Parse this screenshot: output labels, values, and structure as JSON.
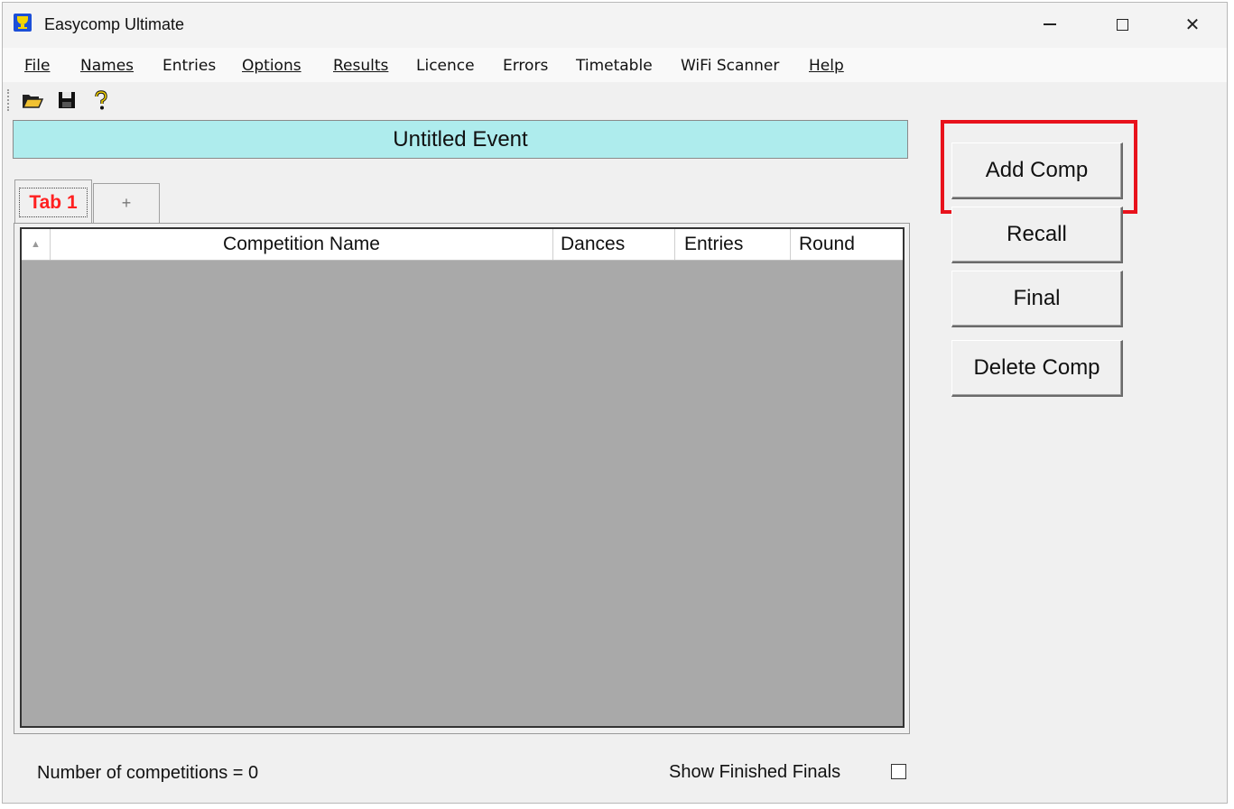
{
  "window": {
    "title": "Easycomp Ultimate",
    "minimize_glyph": "—",
    "close_glyph": "✕"
  },
  "menu": [
    {
      "label": "File"
    },
    {
      "label": "Names"
    },
    {
      "label": "Entries"
    },
    {
      "label": "Options"
    },
    {
      "label": "Results"
    },
    {
      "label": "Licence"
    },
    {
      "label": "Errors"
    },
    {
      "label": "Timetable"
    },
    {
      "label": "WiFi Scanner"
    },
    {
      "label": "Help"
    }
  ],
  "toolbar": {
    "icons": [
      "open-folder-icon",
      "save-disk-icon",
      "help-question-icon"
    ]
  },
  "event": {
    "title": "Untitled Event"
  },
  "tabs": [
    {
      "label": "Tab 1",
      "active": true
    },
    {
      "label": "+"
    }
  ],
  "table": {
    "columns": [
      "Competition Name",
      "Dances",
      "Entries",
      "Round"
    ],
    "rows": []
  },
  "buttons": {
    "add_comp": "Add Comp",
    "recall": "Recall",
    "final": "Final",
    "delete_comp": "Delete Comp"
  },
  "status": {
    "count_text": "Number of competitions = 0",
    "show_finished_label": "Show Finished Finals",
    "show_finished_checked": false
  },
  "colors": {
    "event_banner": "#aeeced",
    "list_background": "#a9a9a9",
    "active_tab_text": "#ff2020",
    "highlight": "#e8121c"
  }
}
